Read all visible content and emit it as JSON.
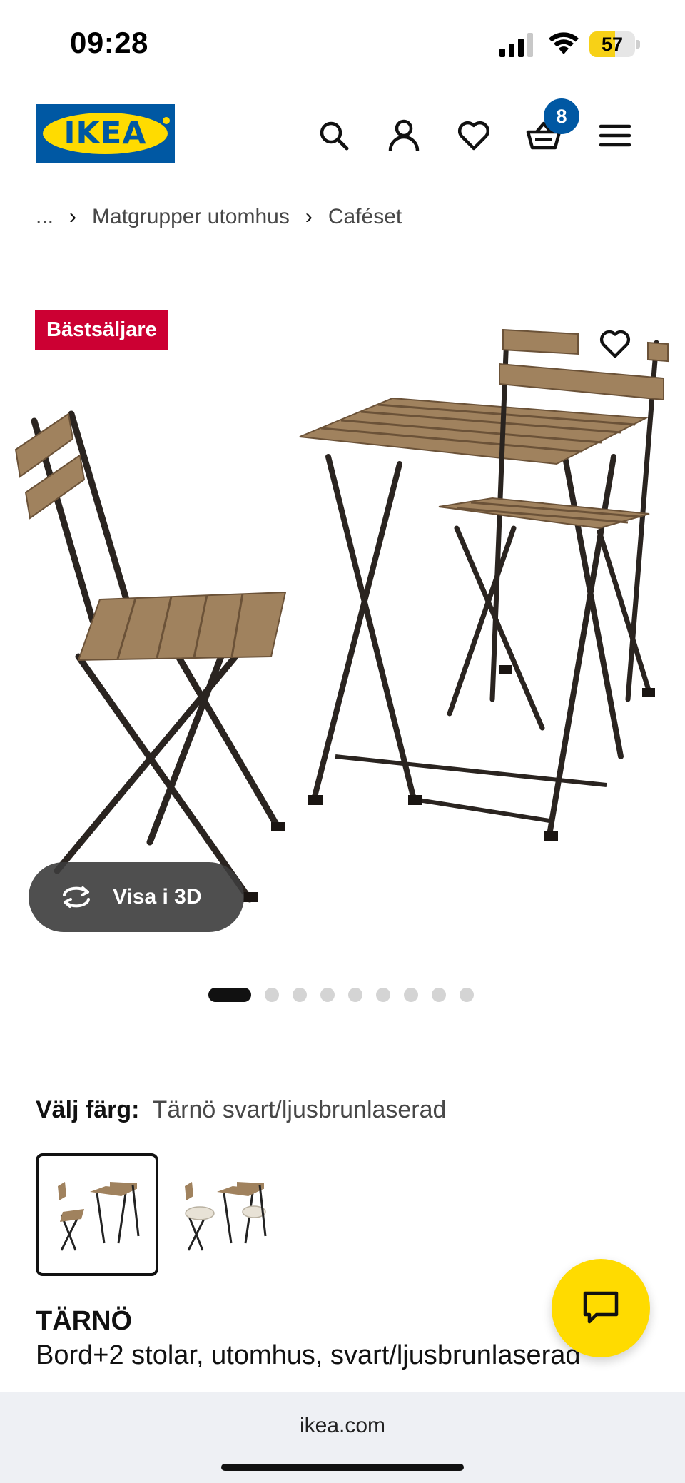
{
  "status_bar": {
    "time": "09:28",
    "battery_level": "57",
    "battery_fraction": 0.57,
    "signal_icon": "cellular-signal-icon",
    "wifi_icon": "wifi-icon"
  },
  "header": {
    "logo_text": "IKEA",
    "cart_count": "8",
    "icons": [
      "search-icon",
      "account-icon",
      "heart-icon",
      "basket-icon",
      "menu-icon"
    ]
  },
  "breadcrumb": {
    "items": [
      "...",
      "Matgrupper utomhus",
      "Caféset"
    ]
  },
  "gallery": {
    "badge": "Bästsäljare",
    "view_3d_label": "Visa i 3D",
    "slide_count": 9,
    "active_slide": 1
  },
  "color_selection": {
    "label": "Välj färg:",
    "value": "Tärnö svart/ljusbrunlaserad",
    "options": [
      "svart/ljusbrunlaserad",
      "with cushions"
    ]
  },
  "product": {
    "name": "TÄRNÖ",
    "description": "Bord+2 stolar, utomhus, svart/ljusbrunlaserad"
  },
  "browser": {
    "address": "ikea.com"
  },
  "colors": {
    "ikea_blue": "#0058a3",
    "ikea_yellow": "#ffdb00",
    "badge_red": "#cc0033"
  }
}
